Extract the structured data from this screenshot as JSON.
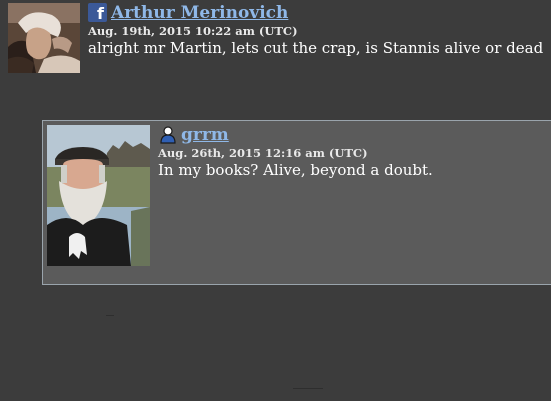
{
  "main_post": {
    "author": "Arthur Merinovich",
    "author_source_icon": "facebook-icon",
    "timestamp": "Aug. 19th, 2015 10:22 am (UTC)",
    "message": "alright mr Martin, lets cut the crap, is Stannis alive or dead"
  },
  "reply": {
    "author": "grrm",
    "author_source_icon": "user-icon",
    "timestamp": "Aug. 26th, 2015 12:16 am (UTC)",
    "message": "In my books? Alive, beyond a doubt."
  },
  "colors": {
    "page_background": "#3c3c3c",
    "reply_background": "#5b5b5b",
    "reply_border": "#9aa4ac",
    "link": "#8fb8e8",
    "text": "#ffffff",
    "facebook": "#3b5998"
  }
}
